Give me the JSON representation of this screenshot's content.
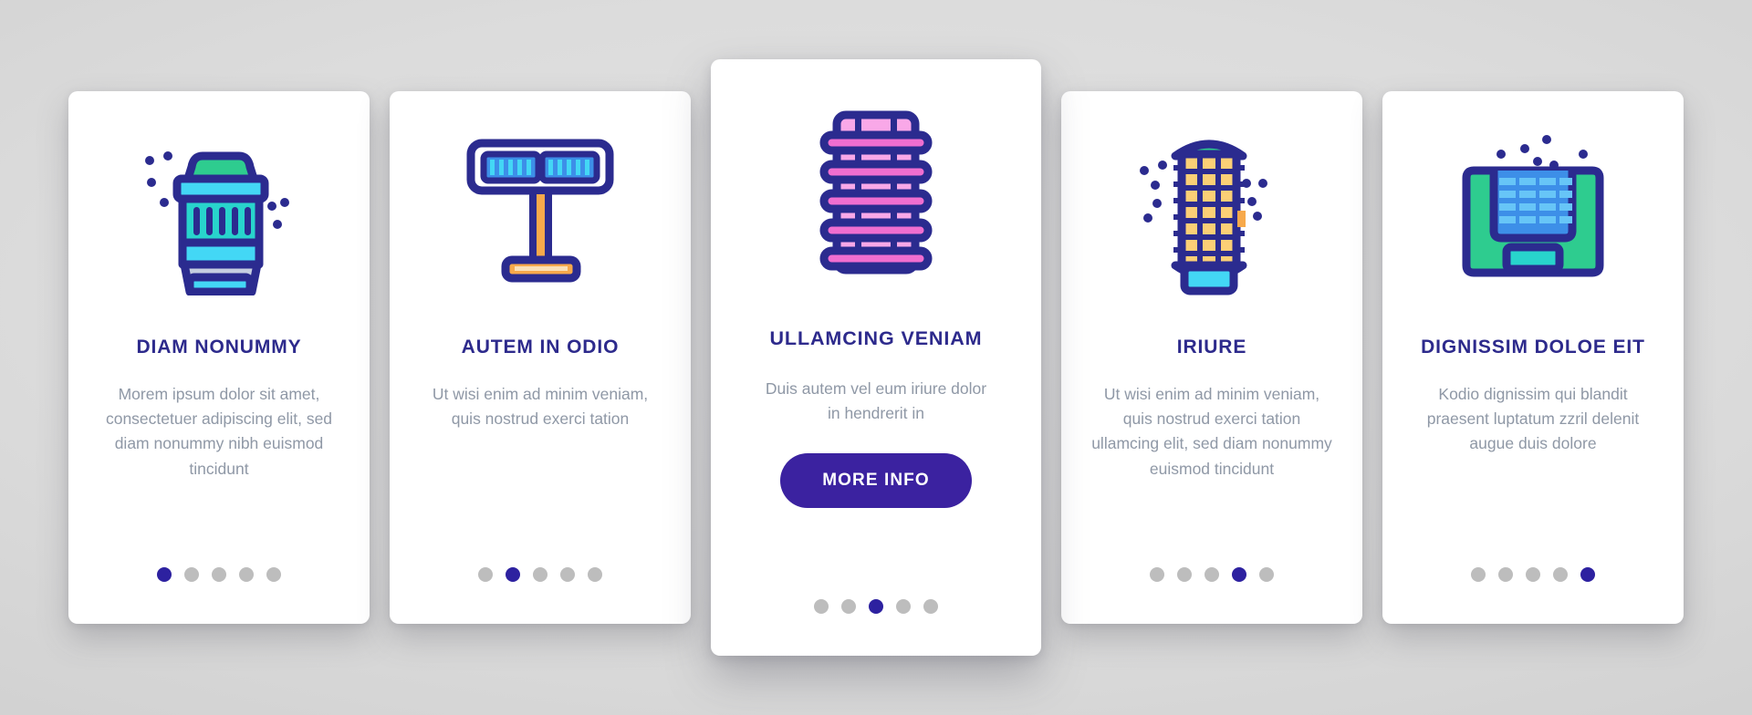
{
  "theme": {
    "background": "#d6d6d6",
    "card_bg": "#ffffff",
    "title_color": "#2d2a8c",
    "body_color": "#8f98a6",
    "accent": "#3b22a0",
    "dot_active": "#2d21a0",
    "dot_inactive": "#bdbdbd",
    "icon_stroke": "#2b2b8f",
    "icon_green": "#2ecc8f",
    "icon_teal": "#28d4cc",
    "icon_cyan": "#43d7f5",
    "icon_blue": "#3d8fe8",
    "icon_lightblue": "#67c5f7",
    "icon_pink": "#f06ed0",
    "icon_lightpink": "#f9a8e8",
    "icon_orange": "#f7a94b",
    "icon_yellow": "#fbcf76",
    "icon_grayblue": "#c5cde0"
  },
  "cards": [
    {
      "id": "card-1",
      "icon_name": "barrel-filter-icon",
      "title": "DIAM NONUMMY",
      "body": "Morem ipsum dolor sit amet, consectetuer adipiscing elit, sed diam nonummy nibh euismod tincidunt",
      "featured": false,
      "cta": null,
      "dots": {
        "count": 5,
        "active_index": 0
      }
    },
    {
      "id": "card-2",
      "icon_name": "t-stand-panel-icon",
      "title": "AUTEM IN ODIO",
      "body": "Ut wisi enim ad minim veniam, quis nostrud exerci tation",
      "featured": false,
      "cta": null,
      "dots": {
        "count": 5,
        "active_index": 1
      }
    },
    {
      "id": "card-3",
      "icon_name": "pink-coil-filter-icon",
      "title": "ULLAMCING VENIAM",
      "body": "Duis autem vel eum iriure dolor in hendrerit in",
      "featured": true,
      "cta": "MORE INFO",
      "dots": {
        "count": 5,
        "active_index": 2
      }
    },
    {
      "id": "card-4",
      "icon_name": "tall-cartridge-filter-icon",
      "title": "IRIURE",
      "body": "Ut wisi enim ad minim veniam, quis nostrud exerci tation ullamcing elit, sed diam nonummy euismod tincidunt",
      "featured": false,
      "cta": null,
      "dots": {
        "count": 5,
        "active_index": 3
      }
    },
    {
      "id": "card-5",
      "icon_name": "panel-grid-filter-icon",
      "title": "DIGNISSIM DOLOE EIT",
      "body": "Kodio dignissim qui blandit praesent luptatum zzril delenit augue duis dolore",
      "featured": false,
      "cta": null,
      "dots": {
        "count": 5,
        "active_index": 4
      }
    }
  ]
}
